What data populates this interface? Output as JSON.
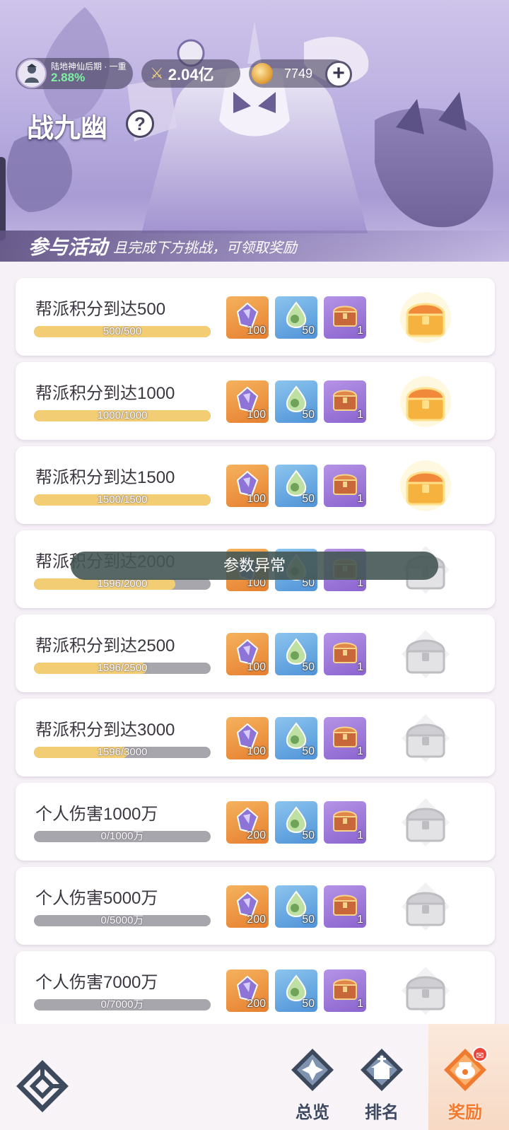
{
  "header": {
    "realm_name": "陆地神仙后期 · 一重",
    "realm_percent": "2.88%",
    "power": "2.04亿",
    "coins": "7749",
    "plus_label": "+",
    "title": "战九幽",
    "help_label": "?"
  },
  "notice": {
    "strong": "参与活动",
    "rest": "且完成下方挑战，可领取奖励"
  },
  "tasks": [
    {
      "title": "帮派积分到达500",
      "progress": "500/500",
      "fraction": 1.0,
      "rewards": [
        "100",
        "50",
        "1"
      ],
      "claimable": true
    },
    {
      "title": "帮派积分到达1000",
      "progress": "1000/1000",
      "fraction": 1.0,
      "rewards": [
        "100",
        "50",
        "1"
      ],
      "claimable": true
    },
    {
      "title": "帮派积分到达1500",
      "progress": "1500/1500",
      "fraction": 1.0,
      "rewards": [
        "100",
        "50",
        "1"
      ],
      "claimable": true
    },
    {
      "title": "帮派积分到达2000",
      "progress": "1596/2000",
      "fraction": 0.798,
      "rewards": [
        "100",
        "50",
        "1"
      ],
      "claimable": false
    },
    {
      "title": "帮派积分到达2500",
      "progress": "1596/2500",
      "fraction": 0.638,
      "rewards": [
        "100",
        "50",
        "1"
      ],
      "claimable": false
    },
    {
      "title": "帮派积分到达3000",
      "progress": "1596/3000",
      "fraction": 0.532,
      "rewards": [
        "100",
        "50",
        "1"
      ],
      "claimable": false
    },
    {
      "title": "个人伤害1000万",
      "progress": "0/1000万",
      "fraction": 0,
      "rewards": [
        "200",
        "50",
        "1"
      ],
      "claimable": false
    },
    {
      "title": "个人伤害5000万",
      "progress": "0/5000万",
      "fraction": 0,
      "rewards": [
        "200",
        "50",
        "1"
      ],
      "claimable": false
    },
    {
      "title": "个人伤害7000万",
      "progress": "0/7000万",
      "fraction": 0,
      "rewards": [
        "200",
        "50",
        "1"
      ],
      "claimable": false
    }
  ],
  "toast": "参数异常",
  "nav": {
    "overview": "总览",
    "ranking": "排名",
    "rewards": "奖励",
    "active": "rewards"
  },
  "colors": {
    "progress_fill": "#f2cd74",
    "progress_track": "#a8a6ad",
    "nav_active": "#f2792d",
    "nav_inactive": "#3f4a62"
  }
}
